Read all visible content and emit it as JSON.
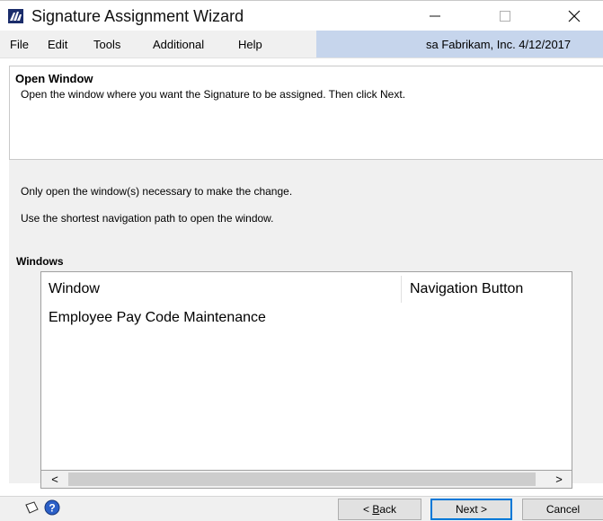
{
  "window": {
    "title": "Signature Assignment Wizard",
    "icons": {
      "app": "dynamics-logo-icon",
      "minimize": "minimize-icon",
      "maximize": "maximize-icon",
      "close": "close-icon"
    }
  },
  "menu": {
    "items": [
      "File",
      "Edit",
      "Tools",
      "Additional",
      "Help"
    ],
    "user_info": "sa  Fabrikam, Inc.  4/12/2017"
  },
  "header": {
    "title": "Open Window",
    "description": "Open the window where you want the Signature to be assigned. Then click Next."
  },
  "instructions": [
    "Only open the window(s) necessary to make the change.",
    "Use the shortest navigation path to open the window."
  ],
  "windows_list": {
    "label": "Windows",
    "columns": [
      "Window",
      "Navigation Button"
    ],
    "rows": [
      {
        "window": "Employee Pay Code Maintenance",
        "navigation_button": ""
      }
    ]
  },
  "scroll": {
    "left": "<",
    "right": ">"
  },
  "buttons": {
    "back_prefix": "< ",
    "back_accel": "B",
    "back_rest": "ack",
    "next": "Next >",
    "cancel": "Cancel"
  },
  "colors": {
    "accent": "#0078d7",
    "user_info_bg": "#c6d5ec",
    "window_bg": "#f0f0f0"
  }
}
